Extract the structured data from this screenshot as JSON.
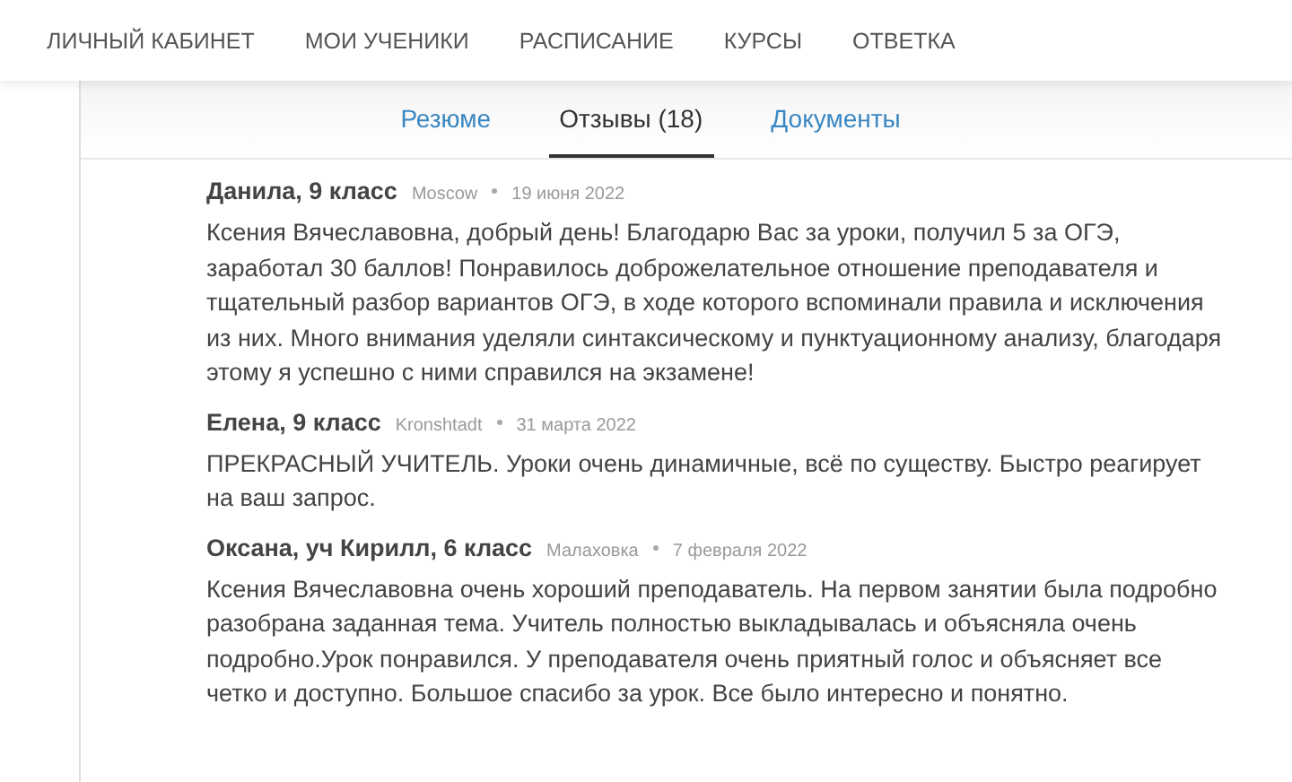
{
  "nav": {
    "items": [
      "ЛИЧНЫЙ КАБИНЕТ",
      "МОИ УЧЕНИКИ",
      "РАСПИСАНИЕ",
      "КУРСЫ",
      "ОТВЕТКА"
    ]
  },
  "tabs": [
    {
      "label": "Резюме",
      "selected": false
    },
    {
      "label": "Отзывы (18)",
      "selected": true
    },
    {
      "label": "Документы",
      "selected": false
    }
  ],
  "reviews": [
    {
      "author": "Данила, 9 класс",
      "location": "Moscow",
      "date": "19 июня 2022",
      "text": "Ксения Вячеславовна, добрый день! Благодарю Вас за уроки, получил 5 за ОГЭ, заработал 30 баллов! Понравилось доброжелательное отношение преподавателя и тщательный разбор вариантов ОГЭ, в ходе которого вспоминали правила и исключения из них. Много внимания уделяли синтаксическому и пунктуационному анализу, благодаря этому я успешно с ними справился на экзамене!"
    },
    {
      "author": "Елена, 9 класс",
      "location": "Kronshtadt",
      "date": "31 марта 2022",
      "text": "ПРЕКРАСНЫЙ УЧИТЕЛЬ. Уроки очень динамичные, всё по существу. Быстро реагирует на ваш запрос."
    },
    {
      "author": "Оксана, уч Кирилл, 6 класс",
      "location": "Малаховка",
      "date": "7 февраля 2022",
      "text": "Ксения Вячеславовна очень хороший преподаватель. На первом занятии была подробно разобрана заданная тема. Учитель полностью выкладывалась и объясняла очень подробно.Урок понравился. У преподавателя очень приятный голос и объясняет все четко и доступно. Большое спасибо за урок. Все было интересно и понятно."
    }
  ]
}
